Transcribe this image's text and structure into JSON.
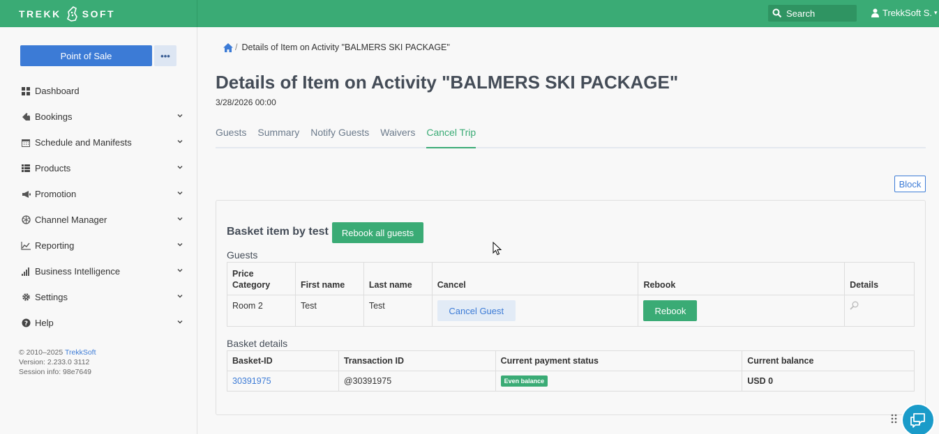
{
  "topbar": {
    "logo_left": "TREKK",
    "logo_right": "SOFT",
    "search_label": "Search",
    "user_name": "TrekkSoft S."
  },
  "sidebar": {
    "pos_label": "Point of Sale",
    "more_label": "•••",
    "items": [
      {
        "label": "Dashboard",
        "icon": "dashboard-icon",
        "chevron": false
      },
      {
        "label": "Bookings",
        "icon": "tag-icon",
        "chevron": true
      },
      {
        "label": "Schedule and Manifests",
        "icon": "calendar-icon",
        "chevron": true
      },
      {
        "label": "Products",
        "icon": "list-icon",
        "chevron": true
      },
      {
        "label": "Promotion",
        "icon": "megaphone-icon",
        "chevron": true
      },
      {
        "label": "Channel Manager",
        "icon": "globe-icon",
        "chevron": true
      },
      {
        "label": "Reporting",
        "icon": "line-chart-icon",
        "chevron": true
      },
      {
        "label": "Business Intelligence",
        "icon": "bar-signal-icon",
        "chevron": true
      },
      {
        "label": "Settings",
        "icon": "gear-icon",
        "chevron": true
      },
      {
        "label": "Help",
        "icon": "question-icon",
        "chevron": true
      }
    ],
    "footer": {
      "copyright": "© 2010–2025 ",
      "brand": "TrekkSoft",
      "version": "Version: 2.233.0 3112",
      "session": "Session info: 98e7649"
    }
  },
  "main": {
    "breadcrumb": "Details of Item on Activity \"BALMERS SKI PACKAGE\"",
    "title": "Details of Item on Activity \"BALMERS SKI PACKAGE\"",
    "date": "3/28/2026 00:00",
    "tabs": [
      {
        "label": "Guests",
        "active": false
      },
      {
        "label": "Summary",
        "active": false
      },
      {
        "label": "Notify Guests",
        "active": false
      },
      {
        "label": "Waivers",
        "active": false
      },
      {
        "label": "Cancel Trip",
        "active": true
      }
    ],
    "block_label": "Block",
    "basket_title": "Basket item by test",
    "rebook_all_label": "Rebook all guests",
    "guests_label": "Guests",
    "guests_table": {
      "headers": [
        "Price Category",
        "First name",
        "Last name",
        "Cancel",
        "Rebook",
        "Details"
      ],
      "rows": [
        {
          "price_category": "Room 2",
          "first_name": "Test",
          "last_name": "Test",
          "cancel_label": "Cancel Guest",
          "rebook_label": "Rebook"
        }
      ]
    },
    "basket_details_label": "Basket details",
    "basket_table": {
      "headers": [
        "Basket-ID",
        "Transaction ID",
        "Current payment status",
        "Current balance"
      ],
      "rows": [
        {
          "basket_id": "30391975",
          "transaction_id": "@30391975",
          "status": "Even balance",
          "balance": "USD 0"
        }
      ]
    }
  },
  "colors": {
    "brand_green": "#3aab75",
    "accent_blue": "#3c7bd6",
    "chat_blue": "#1a9bc9"
  }
}
